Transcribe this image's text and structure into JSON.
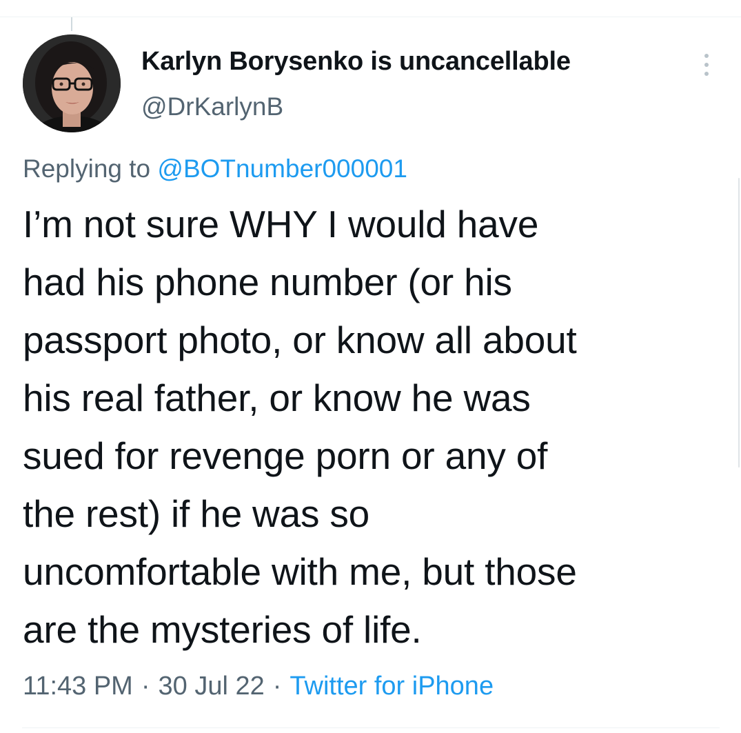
{
  "tweet": {
    "display_name": "Karlyn Borysenko is uncancellable",
    "handle": "@DrKarlynB",
    "reply_prefix": "Replying to",
    "reply_to": "@BOTnumber000001",
    "text_lines": [
      "I’m not sure WHY I would have",
      "had his phone number (or his",
      "passport photo, or know all about",
      "his real father, or know he was",
      "sued for revenge porn or any of",
      "the rest) if he was so",
      "uncomfortable with me, but those",
      "are the mysteries of life."
    ],
    "time": "11:43 PM",
    "date": "30 Jul 22",
    "separator": "·",
    "source": "Twitter for iPhone"
  },
  "icons": {
    "more": "more-vertical-icon",
    "avatar": "profile-photo"
  },
  "colors": {
    "link": "#1d9bf0",
    "secondary_text": "#536471",
    "primary_text": "#0f1419",
    "divider": "#eff3f4"
  }
}
